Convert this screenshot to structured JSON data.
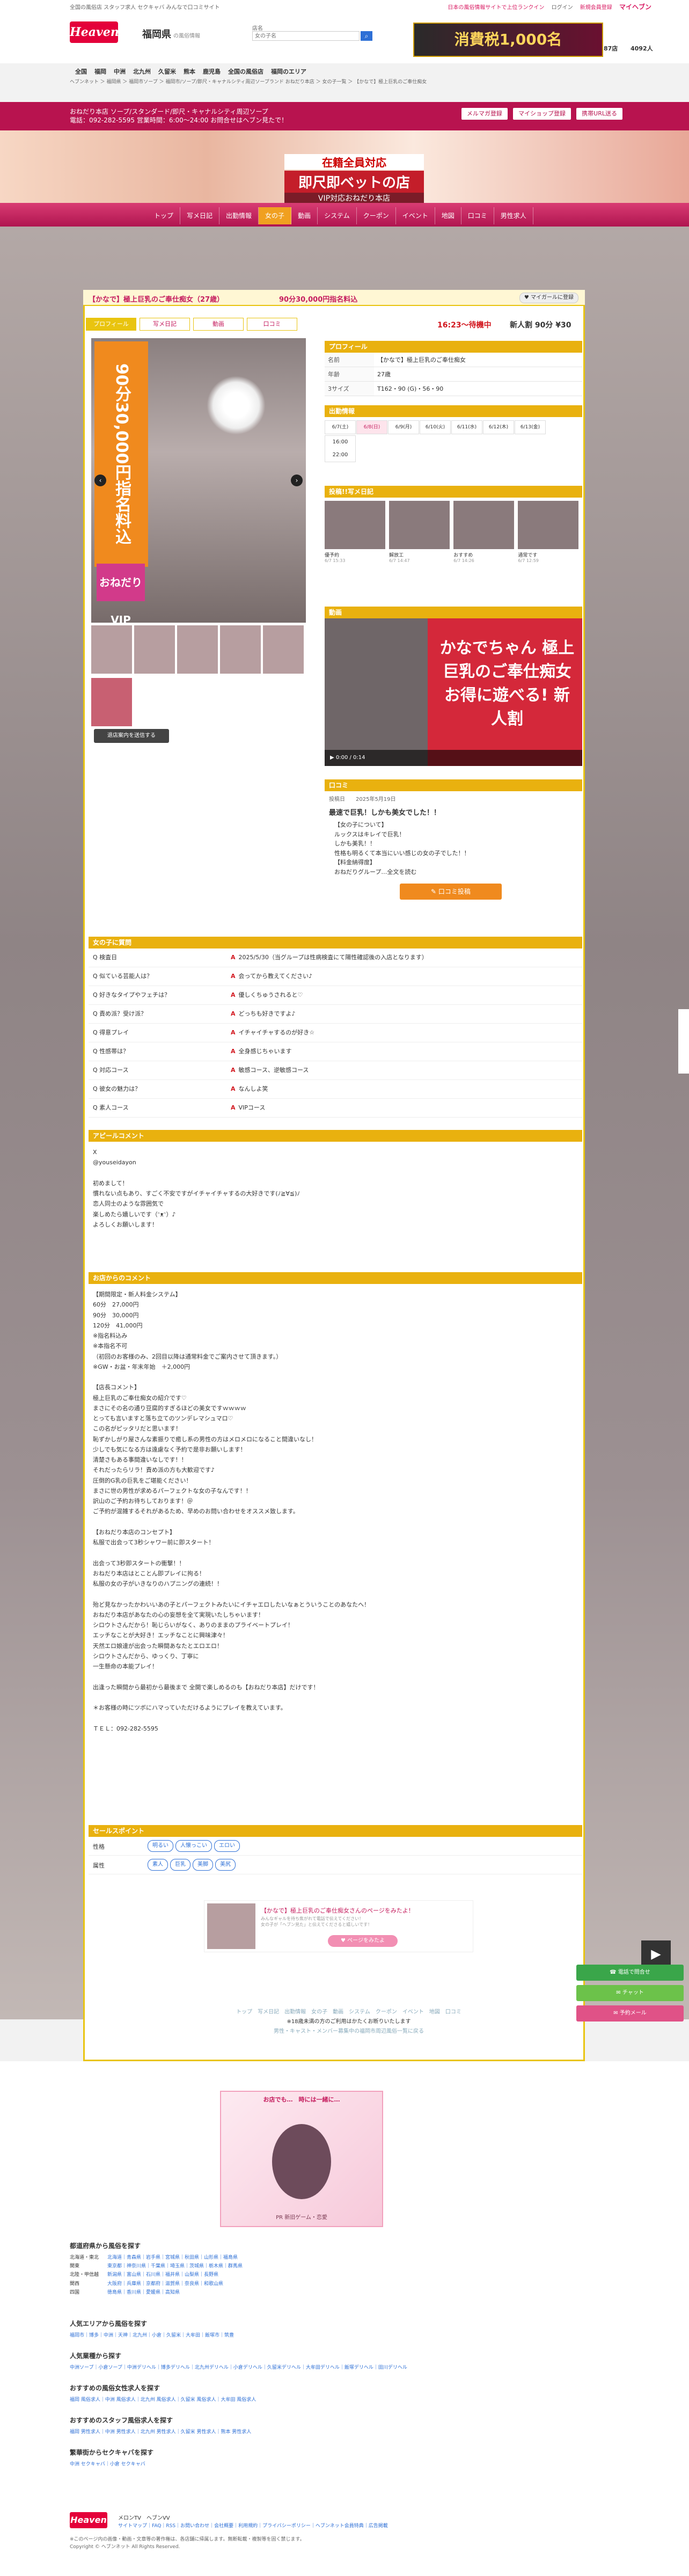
{
  "topbar": {
    "links": "全国の風俗店 スタッフ求人 セクキャバ みんなで口コミサイト",
    "right_text": "日本の風俗情報サイトで上位ランクイン",
    "login": "ログイン",
    "register": "新規会員登録",
    "mypage": "マイヘブン"
  },
  "header": {
    "logo": "Heaven",
    "pref": "福岡県",
    "pref_sub": "の風俗情報",
    "search_label": "店名",
    "search_placeholder": "女の子名",
    "search_icon": "search-icon",
    "banner_text": "消費税1,000名",
    "count1": "87店",
    "count2": "4092人"
  },
  "areas": [
    "全国",
    "福岡",
    "中洲",
    "北九州",
    "久留米",
    "熊本",
    "鹿児島",
    "全国の風俗店",
    "福岡のエリア"
  ],
  "breadcrumb": "ヘブンネット ＞ 福岡県 ＞ 福岡市ソープ ＞ 福岡市/ソープ/即尺・キャナルシティ周辺ソープランド おねだり本店 ＞ 女の子一覧 ＞ 【かなで】極上巨乳のご奉仕痴女",
  "shop": {
    "name": "おねだり本店 ソープ/スタンダード/即尺・キャナルシティ周辺ソープ",
    "tel": "電話：092-282-5595 営業時間：6:00〜24:00 お問合せはヘブン見たで！",
    "btn_mail": "メルマガ登録",
    "btn_mycoupon": "マイショップ登録",
    "btn_mobile": "携帯URL送る"
  },
  "hero": {
    "line1": "在籍全員対応",
    "line2": "即尺即ベットの店",
    "line3": "VIP対応おねだり本店"
  },
  "nav": [
    "トップ",
    "写メ日記",
    "出勤情報",
    "女の子",
    "動画",
    "システム",
    "クーポン",
    "イベント",
    "地図",
    "口コミ",
    "男性求人"
  ],
  "nav_new": "写メ日記",
  "girl": {
    "title": "【かなで】極上巨乳のご奉仕痴女（27歳）",
    "price_title": "90分30,000円指名料込",
    "fav": "マイガールに登録",
    "tabs": [
      "プロフィール",
      "写メ日記",
      "動画",
      "口コミ"
    ],
    "wait": "16:23〜待機中",
    "course": "新人割 90分 ¥30",
    "badge_text": "90分30,000円指名料込",
    "vip": "おねだりVIP",
    "prev": "‹",
    "next": "›",
    "req_btn": "退店案内を送信する"
  },
  "profile": {
    "header": "プロフィール",
    "rows": [
      {
        "k": "名前",
        "v": "【かなで】極上巨乳のご奉仕痴女"
      },
      {
        "k": "年齢",
        "v": "27歳"
      },
      {
        "k": "3サイズ",
        "v": "T162・90 (G)・56・90"
      }
    ]
  },
  "schedule": {
    "header": "出勤情報",
    "days": [
      "6/7(土)",
      "6/8(日)",
      "6/9(月)",
      "6/10(火)",
      "6/11(水)",
      "6/12(木)",
      "6/13(金)"
    ],
    "times": [
      "16:00",
      "22:00"
    ]
  },
  "diary": {
    "header": "投稿!!写メ日記",
    "items": [
      {
        "t": "優予約",
        "d": "6/7 15:33"
      },
      {
        "t": "解放工",
        "d": "6/7 14:47"
      },
      {
        "t": "おすすめ",
        "d": "6/7 14:26"
      },
      {
        "t": "通常です",
        "d": "6/7 12:59"
      }
    ]
  },
  "video": {
    "header": "動画",
    "overlay": "かなでちゃん 極上巨乳のご奉仕痴女 お得に遊べる! 新人割",
    "controls": "▶ 0:00 / 0:14"
  },
  "review": {
    "header": "口コミ",
    "meta": "投稿日　　2025年5月19日",
    "title": "最速で巨乳！しかも美女でした！！",
    "body": "【女の子について】\nルックスはキレイで巨乳！\nしかも美乳！！\n性格も明るくて本当にいい感じの女の子でした！！\n【料金納得度】\nおねだりグループ…全文を読む",
    "btn": "口コミ投稿"
  },
  "qa": {
    "header": "女の子に質問",
    "rows": [
      {
        "q": "Q 検査日",
        "a": "2025/5/30（当グループは性病検査にて陽性確認後の入店となります）"
      },
      {
        "q": "Q 似ている芸能人は？",
        "a": "会ってから教えてください♪"
      },
      {
        "q": "Q 好きなタイプやフェチは？",
        "a": "優しくちゅうされると♡"
      },
      {
        "q": "Q 責め派？受け派？",
        "a": "どっちも好きですよ♪"
      },
      {
        "q": "Q 得意プレイ",
        "a": "イチャイチャするのが好き☆"
      },
      {
        "q": "Q 性感帯は？",
        "a": "全身感じちゃいます"
      },
      {
        "q": "Q 対応コース",
        "a": "敏感コース、逆敏感コース"
      },
      {
        "q": "Q 彼女の魅力は？",
        "a": "なんしよ笑"
      },
      {
        "q": "Q 素人コース",
        "a": "VIPコース"
      }
    ]
  },
  "appeal": {
    "header": "アピールコメント",
    "text": "X\n@youseidayon\n\n初めまして！\n慣れない点もあり、すごく不安ですがイチャイチャするの大好きです(ﾉ≧∀≦)ﾉ\n恋人同士のような雰囲気で\n楽しめたら嬉しいです（ᵔᴥᵔ）♪\nよろしくお願いします！"
  },
  "shopcomment": {
    "header": "お店からのコメント",
    "text": "【期間限定・新人料金システム】\n60分　27,000円\n90分　30,000円\n120分　41,000円\n※指名料込み\n※本指名不可\n（初回のお客様のみ、2回目以降は通常料金でご案内させて頂きます。）\n※GW・お盆・年末年始　＋2,000円\n\n【店長コメント】\n極上巨乳のご奉仕痴女の紹介です♡\nまさにその名の通り豆腐的すぎるほどの美女ですｗｗｗｗ\nとっても言いますと落ち立てのツンデレマシュマロ♡\nこの名がピッタリだと思います！\n恥ずかしがり屋さんな素振りで癒し系の男性の方はメロメロになること間違いなし！\n少しでも気になる方は遠慮なく予約で是非お願いします！\n清楚さもある事間違いなしです！！\nそれだったらリラ！責め派の方も大歓迎です♪\n圧倒的G乳の巨乳をご堪能ください！\nまさに世の男性が求めるパーフェクトな女の子なんです！！\n訳山のご予約お待ちしております！＠\nご予約が混雑するそれがあるため、早めのお問い合わせをオススメ致します。\n\n【おねだり本店のコンセプト】\n私服で出会って3秒シャワー前に即スタート！\n\n出会って3秒即スタートの衝撃！！\nおねだり本店はとことん即プレイに拘る！\n私服の女の子がいきなりのハプニングの連続！！\n\n殆ど見なかったかわいいあの子とパーフェクトみたいにイチャエロしたいなぁとういうことのあなたへ！\nおねだり本店があなたの心の妄想を全て実現いたしちゃいます！\nシロウトさんだから！恥じらいがなく、ありのままのプライベートプレイ！\nエッチなことが大好き！エッチなことに興味津々！\n天然エロ娘達が出会った瞬間あなたとエロエロ！\nシロウトさんだから、ゆっくり、丁寧に\n一生懸命の本能プレイ！\n\n出逢った瞬間から最初から最後まで 全開で楽しめるのも【おねだり本店】だけです！\n\n＊お客様の時にツボにハマっていただけるようにプレイを教えています。\n\nＴＥＬ：092-282-5595"
  },
  "sales": {
    "header": "セールスポイント",
    "rows": [
      {
        "k": "性格",
        "tags": [
          "明るい",
          "人懐っこい",
          "エロい"
        ]
      },
      {
        "k": "属性",
        "tags": [
          "素人",
          "巨乳",
          "美脚",
          "美尻"
        ]
      }
    ]
  },
  "shopbanner": {
    "title": "【かなで】極上巨乳のご奉仕痴女さんのページをみたよ！",
    "sub": "みんなギャルを待ち焦がれて電話で伝えてください！\n女の子が「ヘブン見た」と伝えてくださると嬉しいです！",
    "btn": "ページをみたよ"
  },
  "footnav": {
    "line1": "トップ　写メ日記　出勤情報　女の子　動画　システム　クーポン　イベント　地図　口コミ",
    "line2": "※18歳未満の方のご利用はかたくお断りいたします",
    "line3": "男性・キャスト・メンバー募集中の福岡市周辺風俗一覧に戻る"
  },
  "floats": {
    "phone": "電話で問合せ",
    "chat": "チャット",
    "mail": "予約メール"
  },
  "bigbanner": {
    "top": "お店でも…　時には一緒に…",
    "bottom": "PR 新旧ゲーム・恋愛"
  },
  "linkblocks": [
    {
      "h": "都道府県から風俗を探す",
      "rows": [
        {
          "k": "北海道・東北",
          "v": "北海道｜青森県｜岩手県｜宮城県｜秋田県｜山形県｜福島県"
        },
        {
          "k": "関東",
          "v": "東京都｜神奈川県｜千葉県｜埼玉県｜茨城県｜栃木県｜群馬県"
        },
        {
          "k": "北陸・甲信越",
          "v": "新潟県｜富山県｜石川県｜福井県｜山梨県｜長野県"
        },
        {
          "k": "関西",
          "v": "大阪府｜兵庫県｜京都府｜滋賀県｜奈良県｜和歌山県"
        },
        {
          "k": "四国",
          "v": "徳島県｜香川県｜愛媛県｜高知県"
        }
      ]
    },
    {
      "h": "人気エリアから風俗を探す",
      "rows": [
        {
          "k": "",
          "v": "福岡市｜博多｜中洲｜天神｜北九州｜小倉｜久留米｜大牟田｜飯塚市｜筑豊"
        }
      ]
    },
    {
      "h": "人気業種から探す",
      "rows": [
        {
          "k": "",
          "v": "中洲ソープ｜小倉ソープ｜中洲デリヘル｜博多デリヘル｜北九州デリヘル｜小倉デリヘル｜久留米デリヘル｜大牟田デリヘル｜飯塚デリヘル｜田川デリヘル"
        }
      ]
    },
    {
      "h": "おすすめの風俗女性求人を探す",
      "rows": [
        {
          "k": "",
          "v": "福岡 風俗求人｜中洲 風俗求人｜北九州 風俗求人｜久留米 風俗求人｜大牟田 風俗求人"
        }
      ]
    },
    {
      "h": "おすすめのスタッフ風俗求人を探す",
      "rows": [
        {
          "k": "",
          "v": "福岡 男性求人｜中洲 男性求人｜北九州 男性求人｜久留米 男性求人｜熊本 男性求人"
        }
      ]
    },
    {
      "h": "繁華街からセクキャバを探す",
      "rows": [
        {
          "k": "",
          "v": "中洲 セクキャバ｜小倉 セクキャバ"
        }
      ]
    }
  ],
  "foot": {
    "logo": "Heaven",
    "l1": "メロンTV　ヘブンVV",
    "l2": "サイトマップ｜FAQ｜RSS｜お問い合わせ｜会社概要｜利用規約｜プライバシーポリシー｜ヘブンネット会員特典｜広告掲載",
    "l3": "※このページ内の画像・動画・文章等の著作権は、各店舗に帰属します。無断転載・複製等を固く禁じます。\nCopyright © ヘブンネット All Rights Reserved."
  },
  "colors": {
    "brand": "#e4003a",
    "accent": "#d91c63",
    "gold": "#e9b10f"
  }
}
